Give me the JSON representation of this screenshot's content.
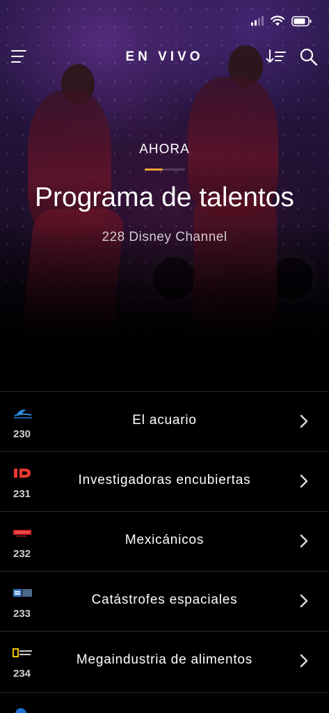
{
  "header": {
    "title": "EN VIVO"
  },
  "hero": {
    "now_label": "AHORA",
    "show_title": "Programa de talentos",
    "channel": "228 Disney Channel",
    "progress": 0.45
  },
  "colors": {
    "accent": "#f2a33a",
    "background": "#000000",
    "divider": "#2b2b2b"
  },
  "listings": [
    {
      "number": "230",
      "title": "El acuario",
      "logo_icon": "wave-channel-logo-icon"
    },
    {
      "number": "231",
      "title": "Investigadoras encubiertas",
      "logo_icon": "id-channel-logo-icon"
    },
    {
      "number": "232",
      "title": "Mexicánicos",
      "logo_icon": "turbo-channel-logo-icon"
    },
    {
      "number": "233",
      "title": "Catástrofes espaciales",
      "logo_icon": "3d-channel-logo-icon"
    },
    {
      "number": "234",
      "title": "Megaindustria de alimentos",
      "logo_icon": "natgeo-channel-logo-icon"
    }
  ]
}
